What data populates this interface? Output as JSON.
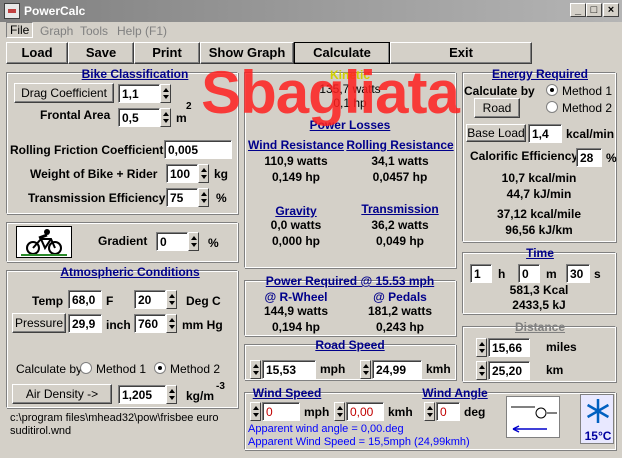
{
  "window": {
    "title": "PowerCalc",
    "min": "_",
    "max": "□",
    "close": "×"
  },
  "menu": [
    "File",
    "Graph",
    "Tools",
    "Help (F1)"
  ],
  "toolbar": {
    "load": "Load",
    "save": "Save",
    "print": "Print",
    "show_graph": "Show Graph",
    "calculate": "Calculate",
    "exit": "Exit"
  },
  "bike": {
    "header": "Bike Classification",
    "drag_button": "Drag Coefficient",
    "drag_value": "1,1",
    "frontal_label": "Frontal Area",
    "frontal_value": "0,5",
    "frontal_unit": "m",
    "frontal_exp": "2",
    "rolling_label": "Rolling Friction Coefficient",
    "rolling_value": "0,005",
    "weight_label": "Weight of Bike + Rider",
    "weight_value": "100",
    "weight_unit": "kg",
    "trans_label": "Transmission Efficiency",
    "trans_value": "75",
    "trans_unit": "%"
  },
  "gradient": {
    "label": "Gradient",
    "value": "0",
    "unit": "%"
  },
  "atmos": {
    "header": "Atmospheric Conditions",
    "temp_label": "Temp",
    "temp_f": "68,0",
    "f_unit": "F",
    "temp_c": "20",
    "c_unit": "Deg C",
    "pressure_button": "Pressure",
    "pressure_inch": "29,9",
    "inch_unit": "inch",
    "pressure_mm": "760",
    "mm_unit": "mm Hg",
    "calc_by": "Calculate by",
    "method1": "Method 1",
    "method2": "Method 2",
    "density_button": "Air Density ->",
    "density_value": "1,205",
    "density_unit": "kg/m",
    "density_exp": "-3"
  },
  "filepath": "c:\\program files\\mhead32\\pow\\frisbee euro suditirol.wnd",
  "watermark": "Sbagliata",
  "losses": {
    "header": "Power Losses",
    "top_label": "Kinetic",
    "top_values": [
      "135,7 watts",
      "0,1 hp"
    ],
    "wind_header": "Wind Resistance",
    "wind_w": "110,9 watts",
    "wind_hp": "0,149 hp",
    "roll_header": "Rolling Resistance",
    "roll_w": "34,1 watts",
    "roll_hp": "0,0457 hp",
    "grav_header": "Gravity",
    "grav_w": "0,0 watts",
    "grav_hp": "0,000 hp",
    "trans_header": "Transmission",
    "trans_w": "36,2 watts",
    "trans_hp": "0,049 hp"
  },
  "power": {
    "header": "Power Required @  15.53 mph",
    "wheel_header": "@ R-Wheel",
    "wheel_w": "144,9 watts",
    "wheel_hp": "0,194 hp",
    "pedal_header": "@ Pedals",
    "pedal_w": "181,2 watts",
    "pedal_hp": "0,243 hp"
  },
  "road": {
    "header": "Road Speed",
    "mph_value": "15,53",
    "mph_unit": "mph",
    "kmh_value": "24,99",
    "kmh_unit": "kmh"
  },
  "wind": {
    "header": "Wind Speed",
    "angle_header": "Wind Angle",
    "mph_value": "0",
    "mph_unit": "mph",
    "kmh_value": "0,00",
    "kmh_unit": "kmh",
    "angle_value": "0",
    "angle_unit": "deg",
    "apparent_angle": "Apparent wind angle = 0,00.deg",
    "apparent_speed": "Apparent Wind Speed = 15,5mph (24,99kmh)"
  },
  "energy": {
    "header": "Energy Required",
    "calc_by": "Calculate by",
    "method1": "Method 1",
    "method2": "Method 2",
    "road_button": "Road",
    "base_button": "Base Load",
    "base_value": "1,4",
    "base_unit": "kcal/min",
    "calorific_label": "Calorific Efficiency",
    "calorific_value": "28",
    "calorific_unit": "%",
    "kcal_min": "10,7 kcal/min",
    "kj_min": "44,7 kJ/min",
    "kcal_mile": "37,12 kcal/mile",
    "kj_km": "96,56 kJ/km"
  },
  "time": {
    "header": "Time",
    "h_value": "1",
    "h_unit": "h",
    "m_value": "0",
    "m_unit": "m",
    "s_value": "30",
    "s_unit": "s",
    "kcal": "581,3 Kcal",
    "kj": "2433,5 kJ"
  },
  "distance": {
    "header": "Distance",
    "miles_value": "15,66",
    "miles_unit": "miles",
    "km_value": "25,20",
    "km_unit": "km"
  },
  "temperature_badge": "15°C",
  "colors": {
    "header_blue": "#00008b",
    "watermark_red": "#ff2020",
    "link_blue": "#0000ff"
  }
}
